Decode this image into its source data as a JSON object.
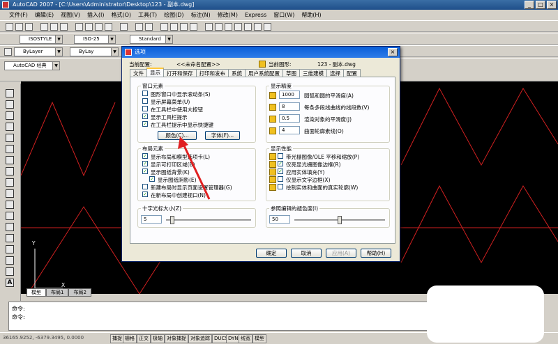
{
  "window": {
    "title": "AutoCAD 2007 - [C:\\Users\\Administrator\\Desktop\\123 - 副本.dwg]"
  },
  "menu": [
    "文件(F)",
    "编辑(E)",
    "视图(V)",
    "插入(I)",
    "格式(O)",
    "工具(T)",
    "绘图(D)",
    "标注(N)",
    "修改(M)",
    "Express",
    "窗口(W)",
    "帮助(H)"
  ],
  "toolbar": {
    "text_style": "ISOSTYLE",
    "dim_style": "ISO-25",
    "table_style": "Standard",
    "layer": "ByLayer",
    "linetype": "ByLay",
    "workspace": "AutoCAD 经典"
  },
  "dialog": {
    "title": "选项",
    "current_profile_label": "当前配置:",
    "current_profile_value": "<<未命名配置>>",
    "current_drawing_label": "当前图形:",
    "current_drawing_value": "123 - 副本.dwg",
    "tabs": [
      "文件",
      "显示",
      "打开和保存",
      "打印和发布",
      "系统",
      "用户系统配置",
      "草图",
      "三维建模",
      "选择",
      "配置"
    ],
    "window_elements": {
      "title": "窗口元素",
      "items": [
        {
          "label": "图形窗口中显示滚动条(S)",
          "checked": false
        },
        {
          "label": "显示屏幕菜单(U)",
          "checked": false
        },
        {
          "label": "在工具栏中使用大按钮",
          "checked": false
        },
        {
          "label": "显示工具栏提示",
          "checked": true
        },
        {
          "label": "在工具栏提示中显示快捷键",
          "checked": true
        }
      ],
      "colors_button": "颜色(C)...",
      "fonts_button": "字体(F)..."
    },
    "display_resolution": {
      "title": "显示精度",
      "items": [
        {
          "value": "1000",
          "label": "圆弧和圆的平滑度(A)"
        },
        {
          "value": "8",
          "label": "每条多段线曲线的线段数(V)"
        },
        {
          "value": "0.5",
          "label": "渲染对象的平滑度(J)"
        },
        {
          "value": "4",
          "label": "曲面轮廓素线(O)"
        }
      ]
    },
    "layout_elements": {
      "title": "布局元素",
      "items": [
        {
          "label": "显示布局和模型选项卡(L)",
          "checked": true
        },
        {
          "label": "显示可打印区域(B)",
          "checked": true
        },
        {
          "label": "显示图纸背景(K)",
          "checked": true
        },
        {
          "label": "显示图纸阴影(E)",
          "checked": true
        },
        {
          "label": "新建布局时显示页面设置管理器(G)",
          "checked": false
        },
        {
          "label": "在新布局中创建视口(N)",
          "checked": true
        }
      ]
    },
    "display_performance": {
      "title": "显示性能",
      "items": [
        {
          "label": "带光栅图像/OLE 平移和缩放(P)",
          "checked": false
        },
        {
          "label": "仅亮显光栅图像边框(R)",
          "checked": true
        },
        {
          "label": "应用实体填充(Y)",
          "checked": true
        },
        {
          "label": "仅显示文字边框(X)",
          "checked": false
        },
        {
          "label": "绘制实体和曲面的真实轮廓(W)",
          "checked": false
        }
      ]
    },
    "crosshair": {
      "title": "十字光标大小(Z)",
      "value": "5",
      "level": 0.05
    },
    "xref_fade": {
      "title": "参照编辑的褪色度(I)",
      "value": "50",
      "level": 0.5
    },
    "buttons": {
      "ok": "确定",
      "cancel": "取消",
      "apply": "应用(A)",
      "help": "帮助(H)"
    }
  },
  "model_tabs": [
    "模型",
    "布局1",
    "布局2"
  ],
  "command": {
    "line1": "命令:",
    "line2": "命令:"
  },
  "status": {
    "coords": "36165.9252, -6379.3495, 0.0000",
    "buttons": [
      "捕捉",
      "栅格",
      "正交",
      "极轴",
      "对象捕捉",
      "对象追踪",
      "DUCS",
      "DYN",
      "线宽",
      "模型"
    ]
  },
  "ucs": {
    "x_label": "X",
    "y_label": "Y"
  }
}
